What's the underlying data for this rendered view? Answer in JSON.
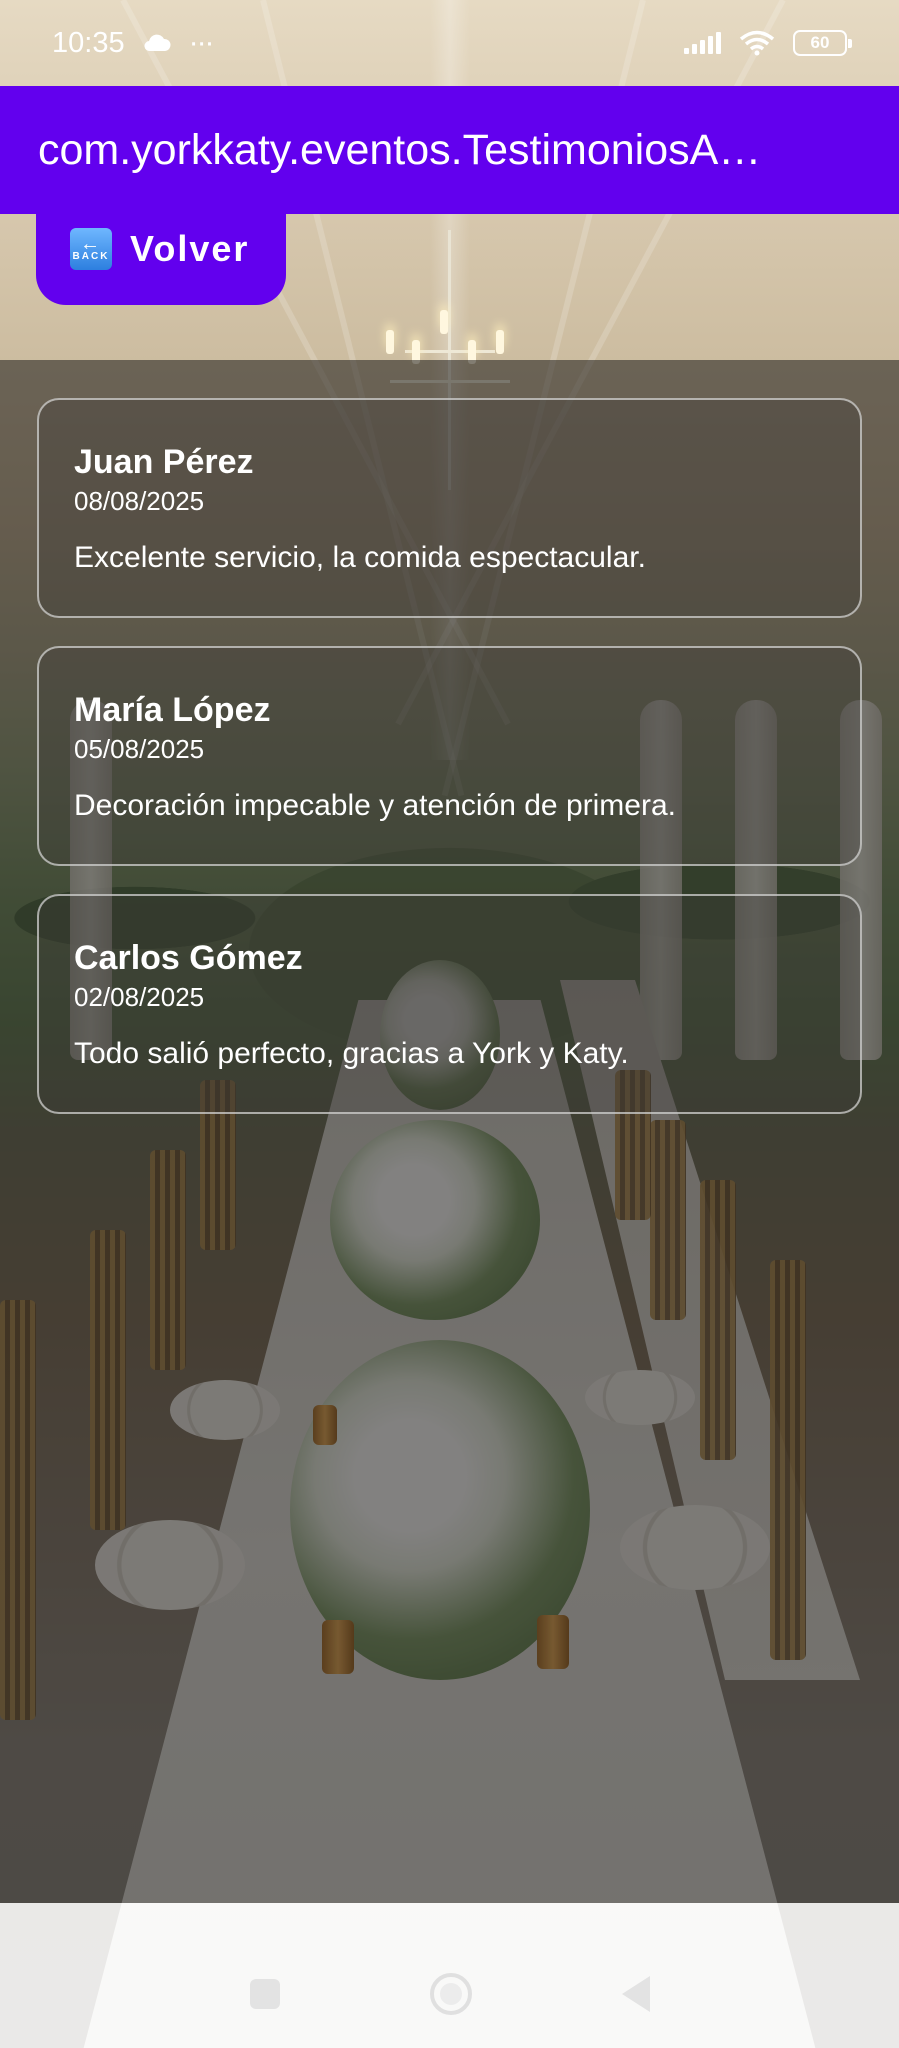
{
  "status_bar": {
    "time": "10:35",
    "cloud_icon": "cloud-icon",
    "more_icon": "···",
    "battery": "60"
  },
  "app_bar": {
    "title": "com.yorkkaty.eventos.TestimoniosA…"
  },
  "back_button": {
    "icon_text": "BACK",
    "label": "Volver"
  },
  "testimonials": [
    {
      "name": "Juan Pérez",
      "date": "08/08/2025",
      "text": "Excelente servicio, la comida espectacular."
    },
    {
      "name": "María López",
      "date": "05/08/2025",
      "text": "Decoración impecable y atención de primera."
    },
    {
      "name": "Carlos Gómez",
      "date": "02/08/2025",
      "text": "Todo salió perfecto, gracias a York y Katy."
    }
  ],
  "colors": {
    "primary": "#6200ee",
    "card_border": "#dcdcdc"
  }
}
